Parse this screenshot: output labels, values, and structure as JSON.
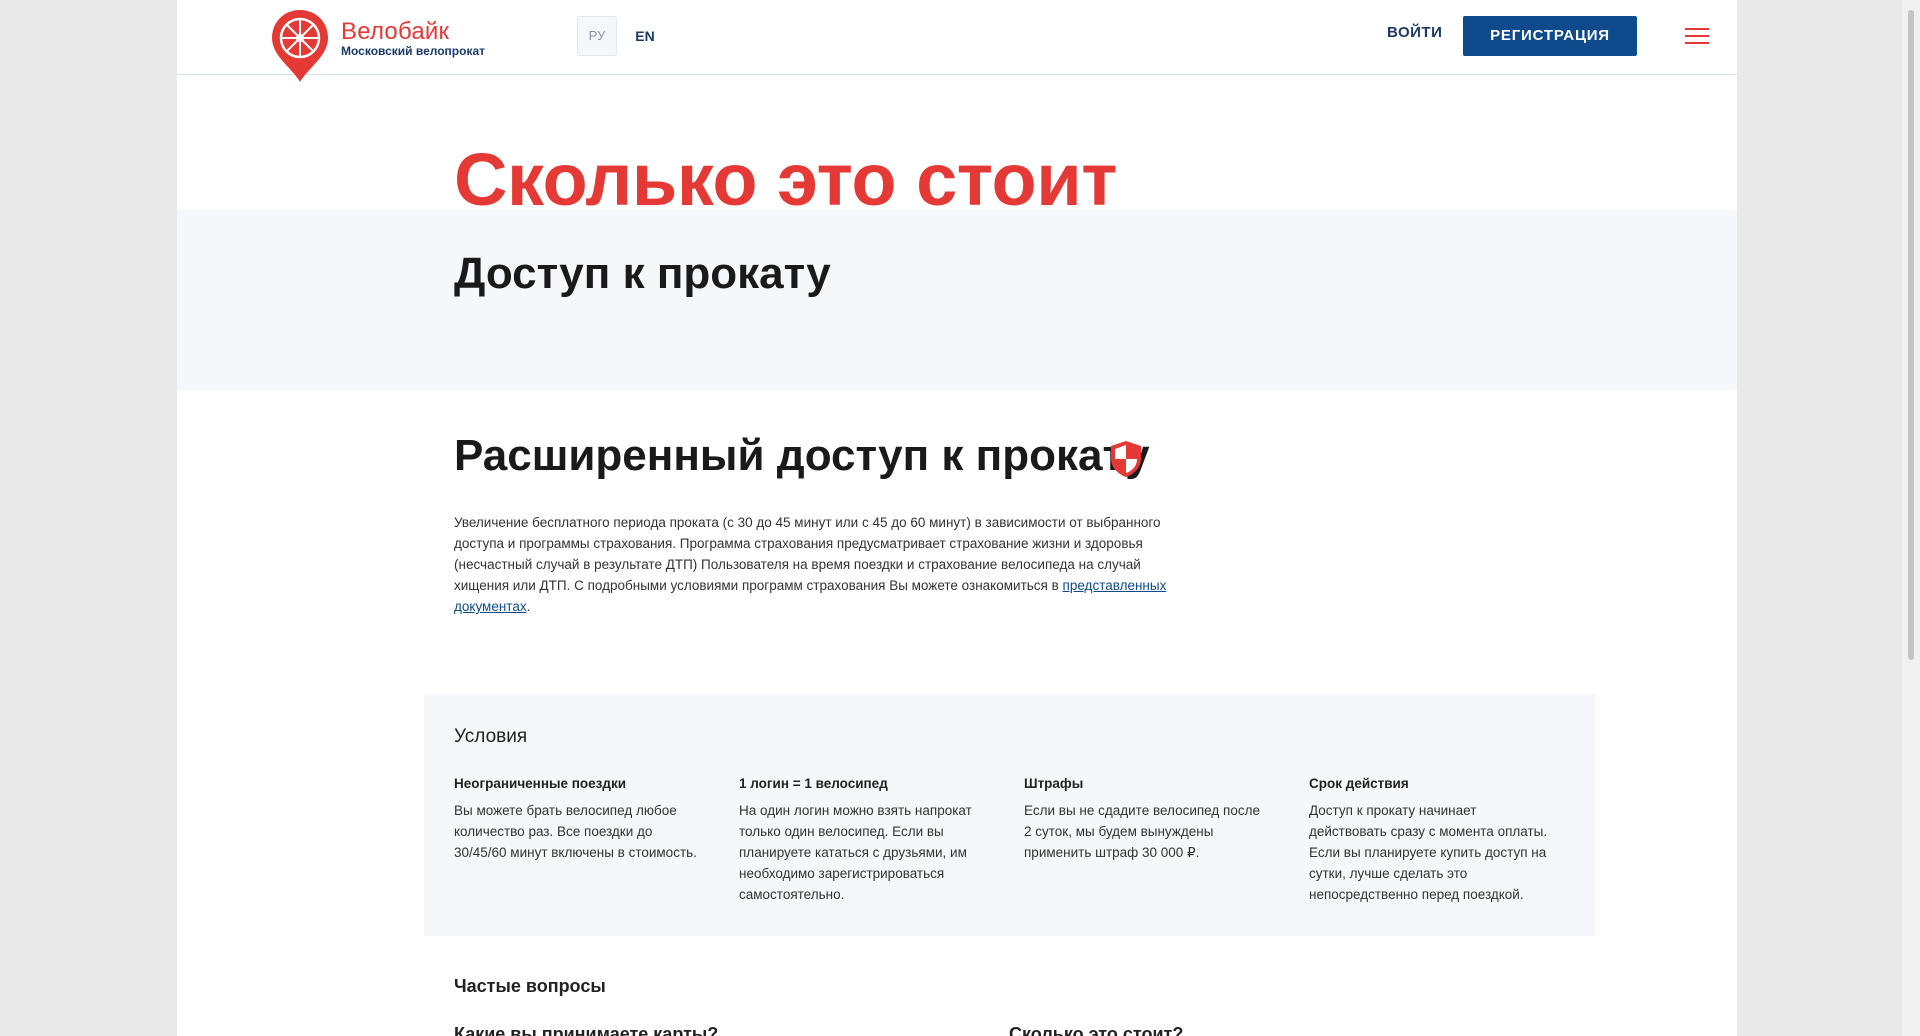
{
  "header": {
    "brand_name": "Велобайк",
    "brand_sub": "Московский велопрокат",
    "lang_ru": "РУ",
    "lang_en": "EN",
    "login": "ВОЙТИ",
    "register": "РЕГИСТРАЦИЯ"
  },
  "hero": {
    "title": "Сколько это стоит",
    "subtitle": "Доступ к прокату"
  },
  "extended": {
    "title": "Расширенный доступ к прокату",
    "description": "Увеличение бесплатного периода проката (с 30 до 45 минут или с 45 до 60 минут) в зависимости от выбранного доступа и программы страхования. Программа страхования предусматривает страхование жизни и здоровья (несчастный случай в результате ДТП) Пользователя на время поездки и страхование велосипеда на случай хищения или ДТП. С подробными условиями программ страхования Вы можете ознакомиться в ",
    "link_text": "представленных документах",
    "description_end": "."
  },
  "conditions": {
    "title": "Условия",
    "items": [
      {
        "heading": "Неограниченные поездки",
        "text": "Вы можете брать велосипед любое количество раз. Все поездки до 30/45/60 минут включены в стоимость."
      },
      {
        "heading": "1 логин = 1 велосипед",
        "text": "На один логин можно взять напрокат только один велосипед. Если вы планируете кататься с друзьями, им необходимо зарегистрироваться самостоятельно."
      },
      {
        "heading": "Штрафы",
        "text": "Если вы не сдадите велосипед после 2 суток, мы будем вынуждены применить штраф 30 000 ₽."
      },
      {
        "heading": "Срок действия",
        "text": "Доступ к прокату начинает действовать сразу с момента оплаты. Если вы планируете купить доступ на сутки, лучше сделать это непосредственно перед поездкой."
      }
    ]
  },
  "faq": {
    "title": "Частые вопросы",
    "questions": [
      "Какие вы принимаете карты?",
      "Сколько это стоит?"
    ]
  },
  "colors": {
    "accent_red": "#e53935",
    "brand_blue": "#0e4a8c",
    "band_bg": "#f5f7fb"
  }
}
